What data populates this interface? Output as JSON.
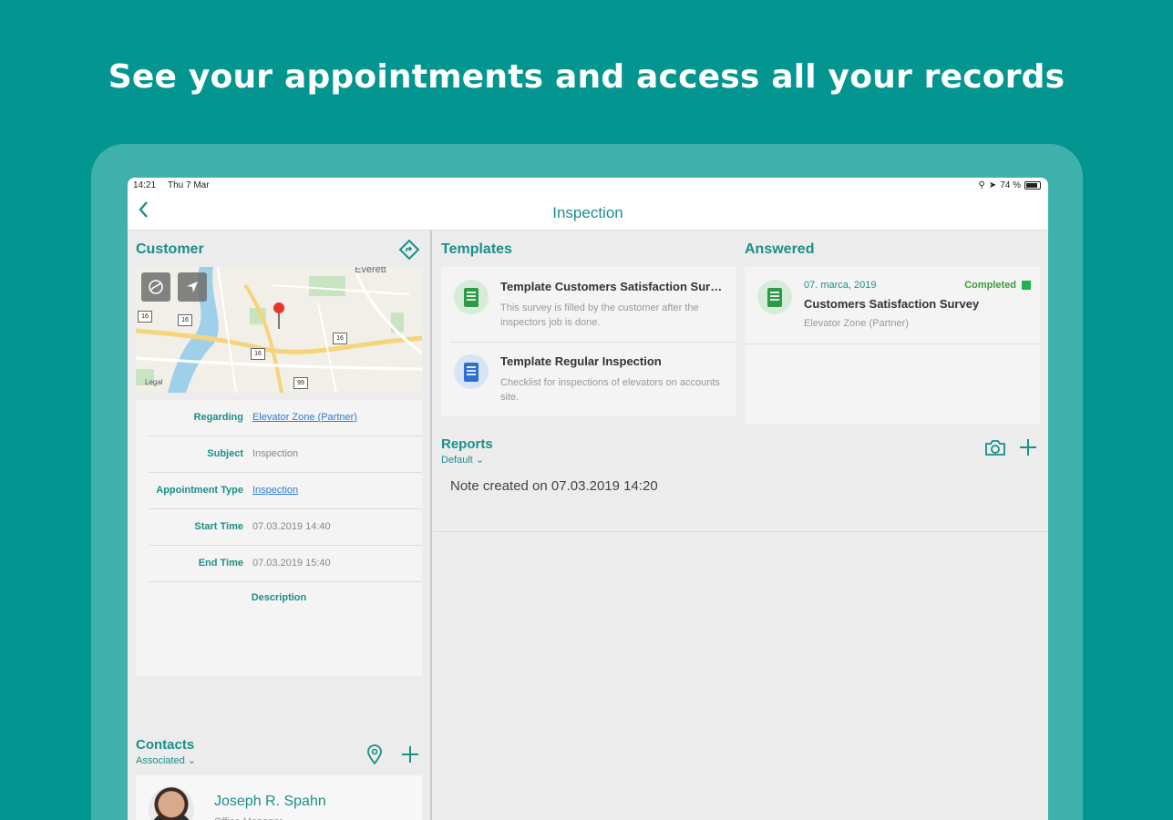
{
  "headline": "See your appointments and access all your records",
  "status_bar": {
    "time": "14:21",
    "date": "Thu 7 Mar",
    "battery": "74 %"
  },
  "nav": {
    "title": "Inspection",
    "back_icon": "chevron-left-icon"
  },
  "customer": {
    "title": "Customer",
    "map_labels": {
      "town": "Everett",
      "road_numbers": [
        "16",
        "16",
        "16",
        "16",
        "99"
      ],
      "map_credit": "Legal"
    },
    "fields": [
      {
        "label": "Regarding",
        "value": "Elevator Zone (Partner)",
        "link": true
      },
      {
        "label": "Subject",
        "value": "Inspection",
        "link": false
      },
      {
        "label": "Appointment Type",
        "value": "Inspection",
        "link": true
      },
      {
        "label": "Start Time",
        "value": "07.03.2019 14:40",
        "link": false
      },
      {
        "label": "End Time",
        "value": "07.03.2019 15:40",
        "link": false
      }
    ],
    "description_label": "Description"
  },
  "contacts": {
    "title": "Contacts",
    "filter": "Associated",
    "items": [
      {
        "name": "Joseph R. Spahn",
        "role": "Office Manager"
      }
    ]
  },
  "templates": {
    "title": "Templates",
    "items": [
      {
        "title": "Template Customers Satisfaction Survey",
        "desc": "This survey is filled by the customer after the inspectors job is done.",
        "color": "#2e9a45",
        "bg": "#d6ecd9"
      },
      {
        "title": "Template Regular Inspection",
        "desc": "Checklist for inspections of elevators on accounts site.",
        "color": "#2f6fd0",
        "bg": "#d8e3f4"
      }
    ]
  },
  "answered": {
    "title": "Answered",
    "items": [
      {
        "date": "07. marca, 2019",
        "status": "Completed",
        "title": "Customers Satisfaction Survey",
        "desc": "Elevator Zone (Partner)",
        "color": "#2e9a45",
        "bg": "#d6ecd9",
        "status_color": "#22b14c"
      }
    ]
  },
  "reports": {
    "title": "Reports",
    "filter": "Default",
    "note": "Note created on 07.03.2019 14:20"
  },
  "colors": {
    "background": "#039690",
    "accent": "#1a8f8a",
    "link": "#2f7bd3"
  }
}
